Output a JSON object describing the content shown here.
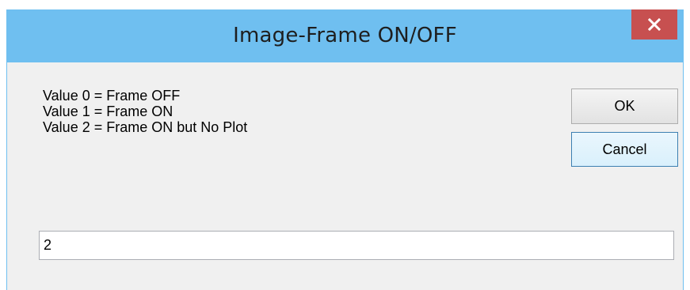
{
  "window": {
    "title": "Image-Frame ON/OFF"
  },
  "prompt": {
    "lines": [
      "Value 0 = Frame OFF",
      "Value 1 = Frame ON",
      "Value 2 = Frame ON but No Plot"
    ]
  },
  "buttons": {
    "ok_label": "OK",
    "cancel_label": "Cancel"
  },
  "input": {
    "value": "2"
  },
  "icons": {
    "close": "close-icon"
  },
  "colors": {
    "titlebar": "#6fbff0",
    "close_button": "#c75050",
    "client_background": "#f0f0f0"
  }
}
